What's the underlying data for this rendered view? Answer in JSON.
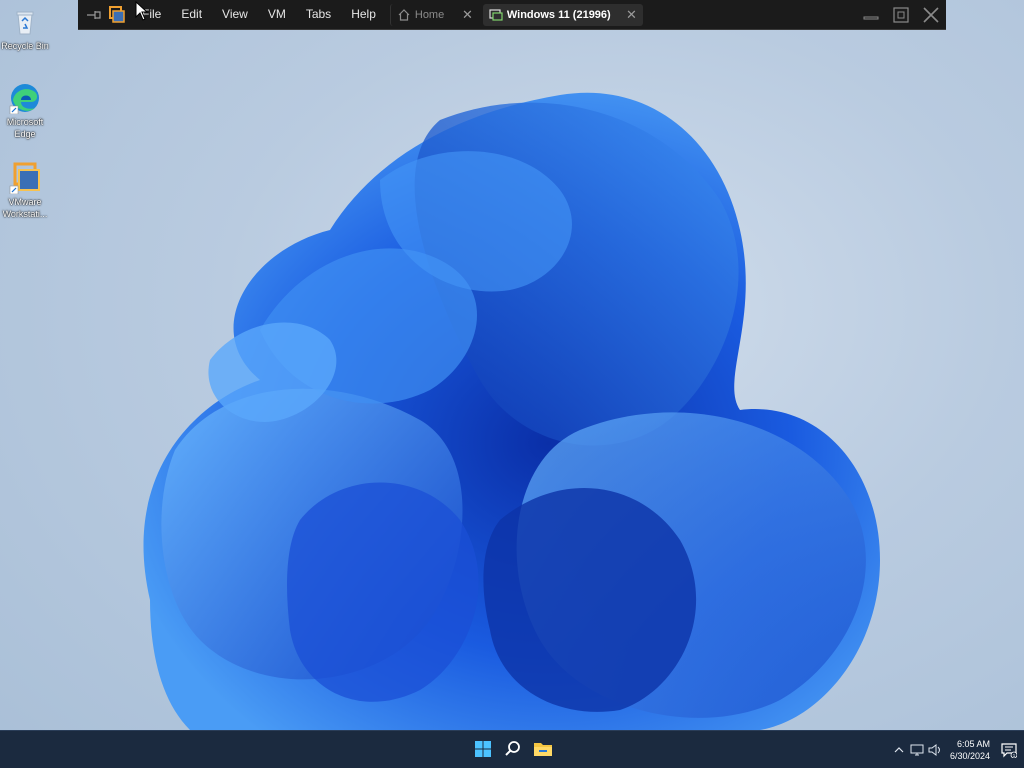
{
  "desktop": {
    "icons": [
      {
        "label": "Recycle Bin",
        "icon": "recycle-bin-icon"
      },
      {
        "label": "Microsoft Edge",
        "icon": "edge-icon"
      },
      {
        "label": "VMware Workstati...",
        "icon": "vmware-icon"
      }
    ]
  },
  "vmware": {
    "menu": [
      "File",
      "Edit",
      "View",
      "VM",
      "Tabs",
      "Help"
    ],
    "tabs": [
      {
        "label": "Home",
        "icon": "home-icon",
        "active": false
      },
      {
        "label": "Windows 11 (21996)",
        "icon": "vm-icon",
        "active": true
      }
    ],
    "colors": {
      "bar": "#1b1b1b",
      "accent": "#f0a030"
    }
  },
  "taskbar": {
    "pinned": [
      "start-icon",
      "search-icon",
      "file-explorer-icon"
    ],
    "tray": {
      "time": "6:05 AM",
      "date": "6/30/2024",
      "notification_count": "1"
    }
  }
}
